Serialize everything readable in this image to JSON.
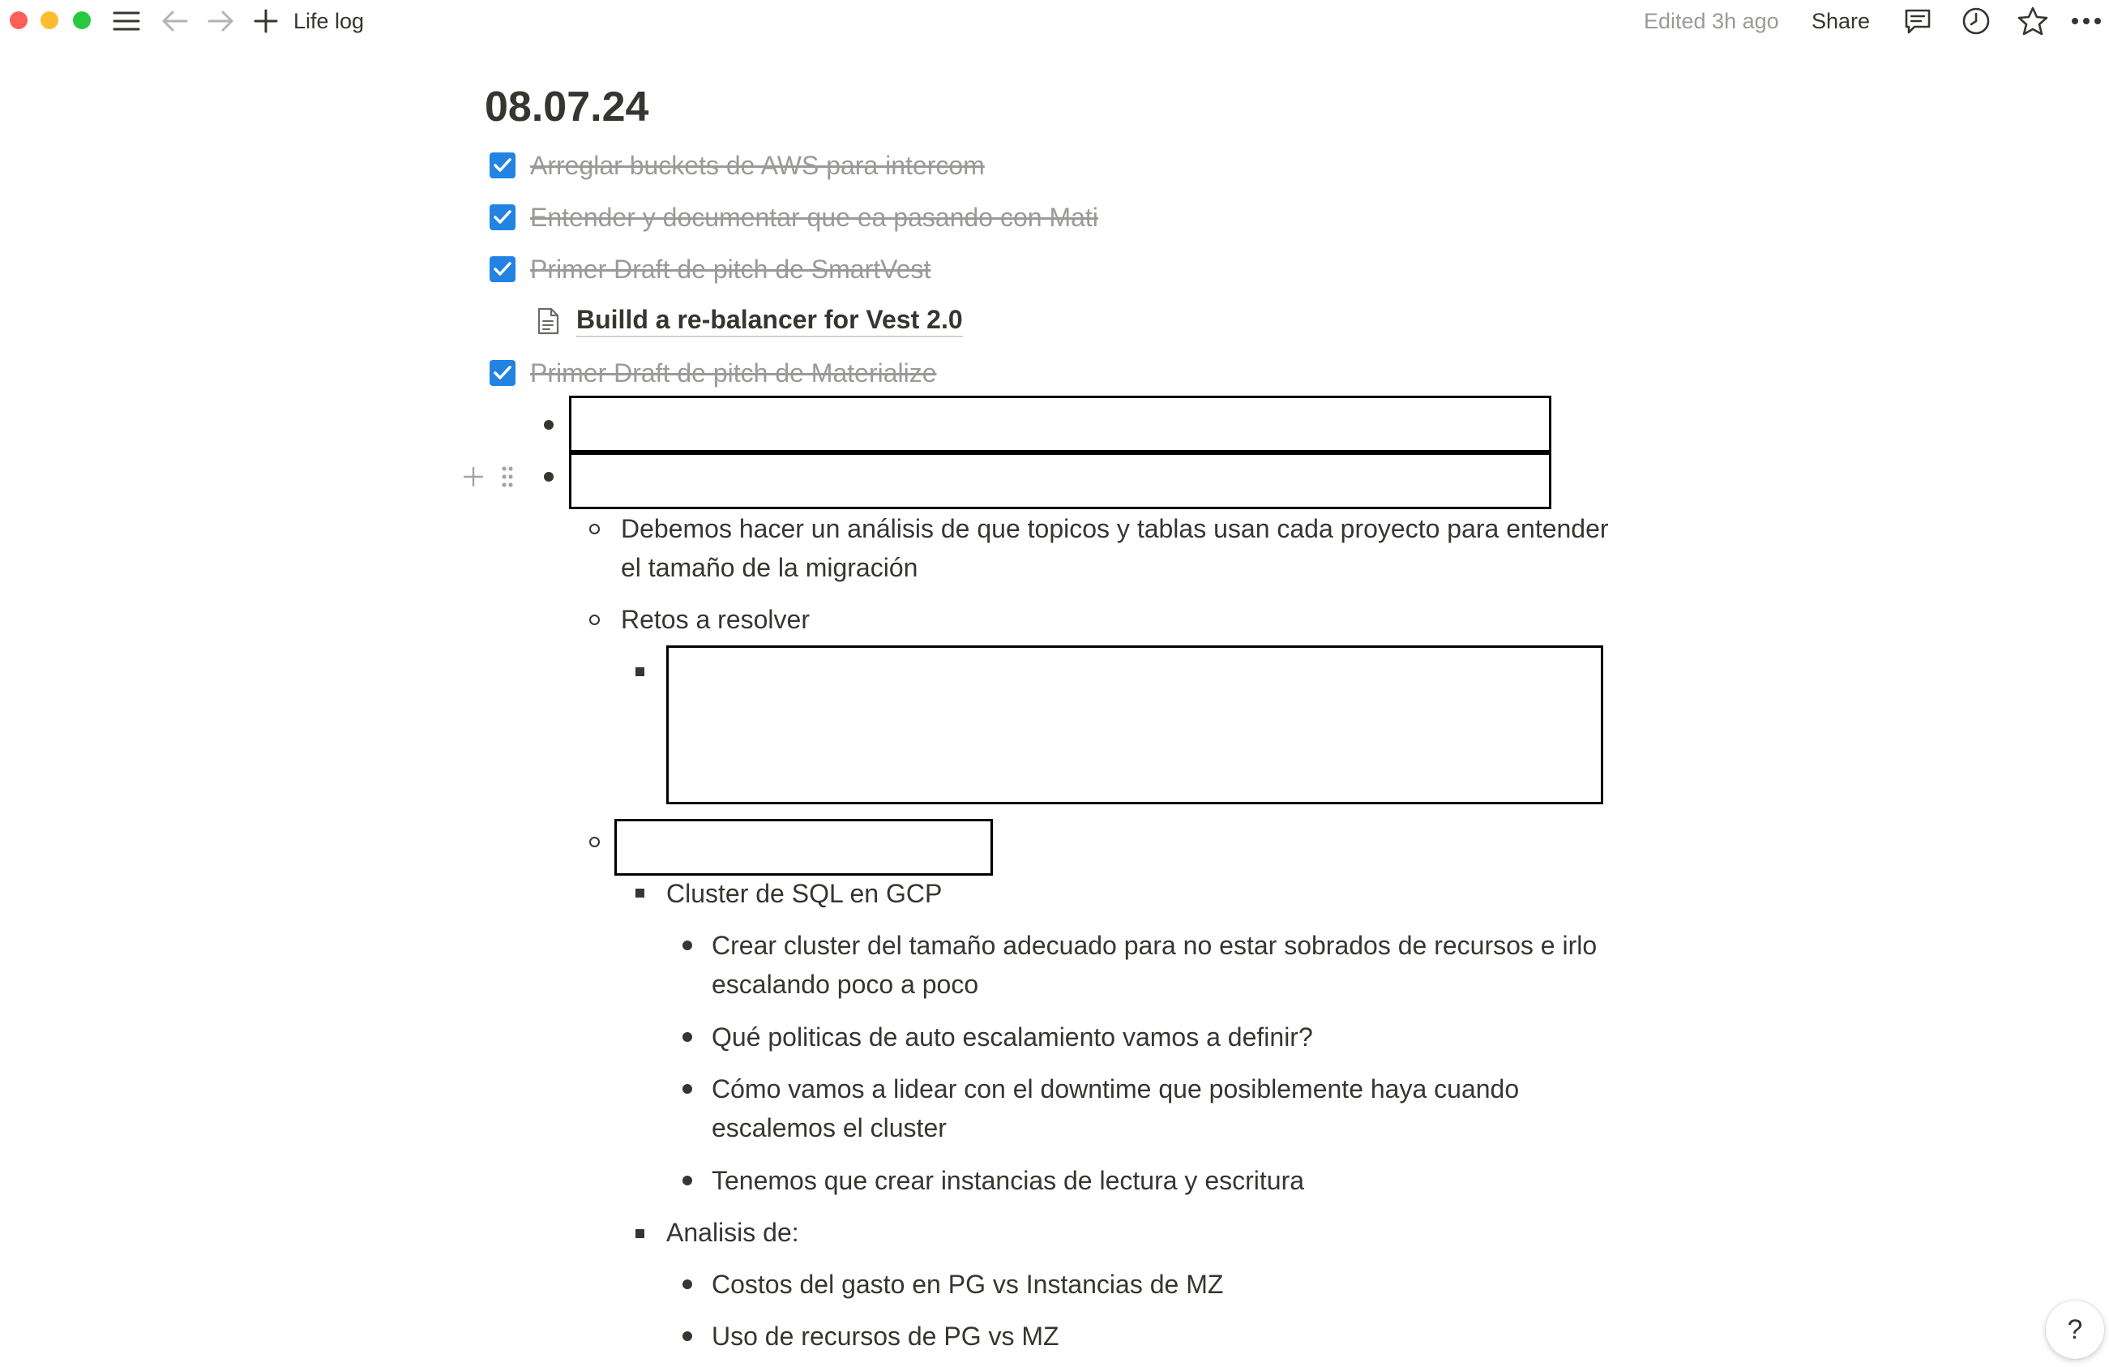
{
  "window": {
    "buttons": [
      "close",
      "minimize",
      "zoom"
    ]
  },
  "topbar": {
    "icons": [
      "sidebar-menu-icon",
      "back-arrow-icon",
      "forward-arrow-icon",
      "new-page-plus-icon"
    ],
    "page_title": "Life log",
    "edited": "Edited 3h ago",
    "share_label": "Share",
    "right_icons": [
      "comments-icon",
      "updates-clock-icon",
      "favorite-star-icon",
      "more-options-icon"
    ]
  },
  "document": {
    "title": "08.07.24",
    "todos": [
      {
        "label": "Arreglar buckets de AWS para intercom",
        "checked": true
      },
      {
        "label": "Entender y documentar que ea pasando con Mati",
        "checked": true
      },
      {
        "label": "Primer Draft de pitch de SmartVest",
        "checked": true
      },
      {
        "label": "Primer Draft de pitch de Materialize",
        "checked": true
      }
    ],
    "subpage_link": "Builld a re-balancer for Vest 2.0",
    "nested": {
      "analysis_line1": "Debemos hacer un análisis de que topicos y tablas usan cada proyecto para entender",
      "analysis_line2": "el tamaño de la migración",
      "retos": "Retos a resolver",
      "cluster_heading": "Cluster de SQL en GCP",
      "cluster_items": [
        {
          "line1": "Crear cluster del tamaño adecuado para no estar sobrados de recursos e irlo",
          "line2": "escalando poco a poco"
        },
        {
          "line1": "Qué politicas de auto escalamiento vamos a definir?"
        },
        {
          "line1": "Cómo vamos a lidear con el downtime que posiblemente haya cuando",
          "line2": "escalemos el cluster"
        },
        {
          "line1": "Tenemos que crear instancias de lectura y escritura"
        }
      ],
      "analisis_heading": "Analisis de:",
      "analisis_items": [
        "Costos del gasto en PG vs Instancias de MZ",
        "Uso de recursos de PG vs MZ"
      ]
    }
  },
  "help_label": "?",
  "colors": {
    "text": "#37352f",
    "muted": "#9b9a97",
    "checkbox": "#2383e2"
  }
}
